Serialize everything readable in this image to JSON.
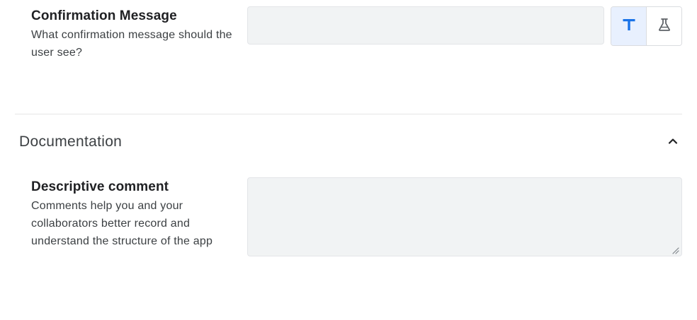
{
  "confirmation": {
    "label": "Confirmation Message",
    "help": "What confirmation message should the user see?",
    "value": "",
    "modes": [
      {
        "name": "text",
        "icon": "text-format-icon",
        "active": true
      },
      {
        "name": "formula",
        "icon": "flask-icon",
        "active": false
      }
    ]
  },
  "documentation": {
    "title": "Documentation",
    "expanded": true,
    "collapse_icon": "chevron-up-icon",
    "comment": {
      "label": "Descriptive comment",
      "help": "Comments help you and your collaborators better record and understand the structure of the app",
      "value": ""
    }
  },
  "colors": {
    "active_mode_bg": "#e8f0fe",
    "active_mode_icon": "#1a73e8",
    "input_bg": "#f1f3f4"
  }
}
